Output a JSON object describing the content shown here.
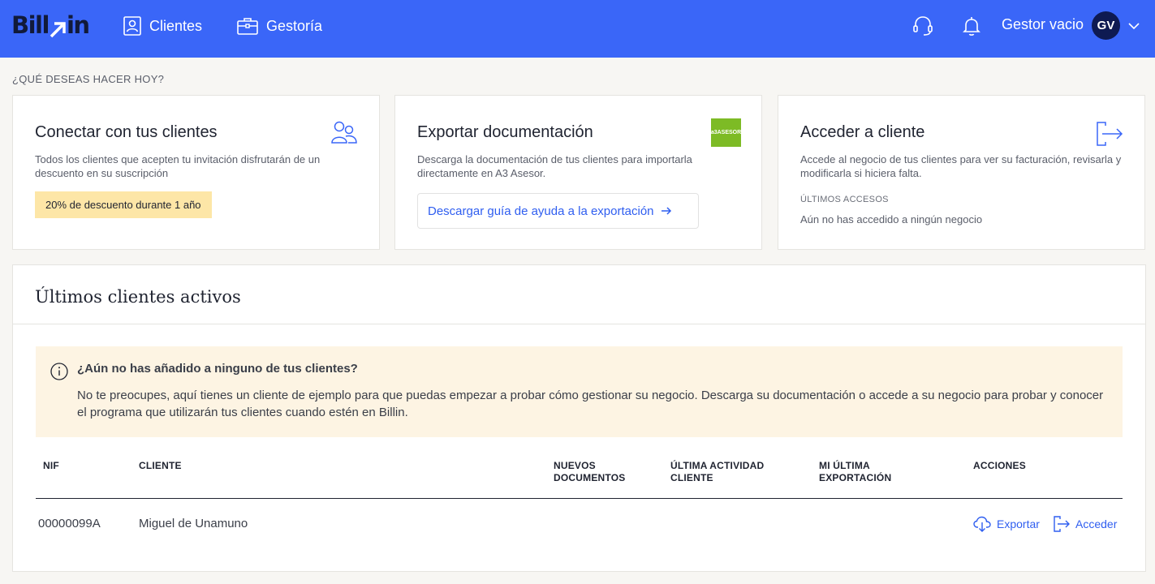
{
  "header": {
    "logo": "Billin",
    "nav": [
      {
        "label": "Clientes",
        "icon": "contact-card-icon"
      },
      {
        "label": "Gestoría",
        "icon": "briefcase-icon"
      }
    ],
    "user_name": "Gestor vacio",
    "avatar_initials": "GV",
    "accent_color": "#3a66f8"
  },
  "section_title": "¿QUÉ DESEAS HACER HOY?",
  "cards": {
    "connect": {
      "title": "Conectar con tus clientes",
      "description": "Todos los clientes que acepten tu invitación disfrutarán de un descuento en su suscripción",
      "badge": "20% de descuento durante 1 año",
      "icon": "users-icon"
    },
    "export": {
      "title": "Exportar documentación",
      "description": "Descarga la documentación de tus clientes para importarla directamente en A3 Asesor.",
      "logo_text": "a3ASESOR",
      "button_label": "Descargar guía de ayuda a la exportación"
    },
    "access": {
      "title": "Acceder a cliente",
      "description": "Accede al negocio de tus clientes para ver su facturación, revisarla y modificarla si hiciera falta.",
      "recent_label": "ÚLTIMOS ACCESOS",
      "recent_empty": "Aún no has accedido a ningún negocio",
      "icon": "sign-in-icon"
    }
  },
  "clients_panel": {
    "title": "Últimos clientes activos",
    "notice": {
      "title": "¿Aún no has añadido a ninguno de tus clientes?",
      "body": "No te preocupes, aquí tienes un cliente de ejemplo para que puedas empezar a probar cómo gestionar su negocio. Descarga su documentación o accede a su negocio para probar y conocer el programa que utilizarán tus clientes cuando estén en Billin."
    },
    "columns": [
      "NIF",
      "CLIENTE",
      "NUEVOS\nDOCUMENTOS",
      "ÚLTIMA ACTIVIDAD\nCLIENTE",
      "MI ÚLTIMA\nEXPORTACIÓN",
      "ACCIONES"
    ],
    "rows": [
      {
        "nif": "00000099A",
        "client": "Miguel de Unamuno",
        "new_docs": "",
        "last_activity": "",
        "my_last_export": ""
      }
    ],
    "actions": {
      "export": "Exportar",
      "access": "Acceder"
    }
  }
}
